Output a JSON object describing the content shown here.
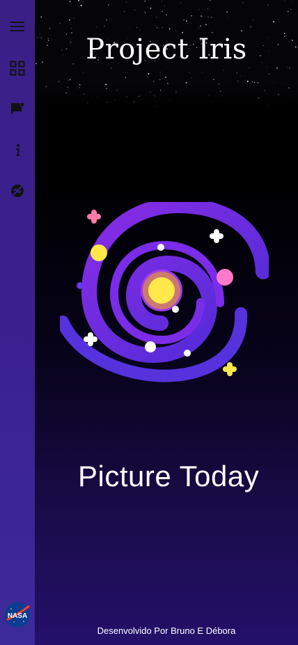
{
  "app": {
    "title": "Project Iris"
  },
  "sidebar": {
    "items": [
      {
        "icon": "menu-icon"
      },
      {
        "icon": "dashboard-grid-icon"
      },
      {
        "icon": "feedback-icon"
      },
      {
        "icon": "info-icon"
      },
      {
        "icon": "no-signal-icon"
      }
    ],
    "logo": {
      "icon": "nasa-logo",
      "text": "NASA"
    }
  },
  "main": {
    "illustration": "galaxy-illustration",
    "heading": "Picture Today",
    "footer": "Desenvolvido Por Bruno E Débora"
  },
  "colors": {
    "sidebar": "#3b2191",
    "galaxy_outer": "#5b2bd8",
    "galaxy_mid": "#8f2cf0",
    "galaxy_core": "#ffe94a",
    "accent_pink": "#ff7ac8",
    "accent_yellow": "#ffe94a"
  }
}
